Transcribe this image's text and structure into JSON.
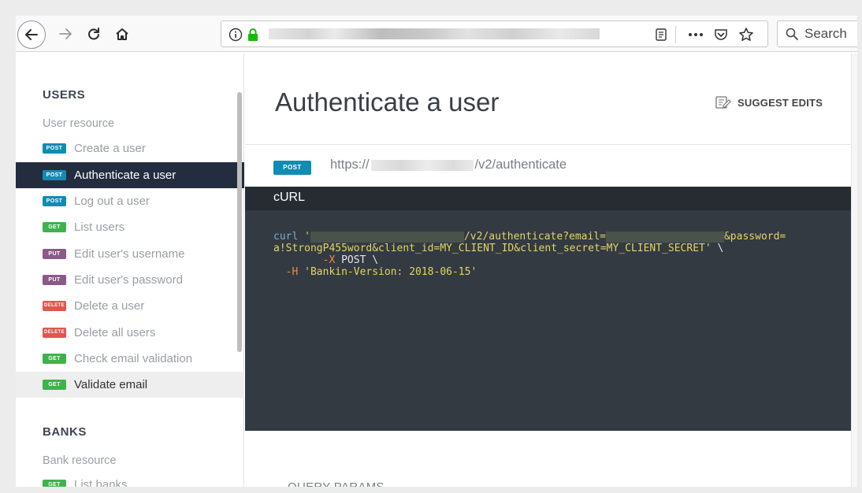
{
  "browser": {
    "search_label": "Search"
  },
  "sidebar": {
    "sections": [
      {
        "title": "USERS",
        "subtitle": "User resource"
      },
      {
        "title": "BANKS",
        "subtitle": "Bank resource"
      }
    ],
    "items": [
      {
        "method": "POST",
        "label": "Create a user"
      },
      {
        "method": "POST",
        "label": "Authenticate a user"
      },
      {
        "method": "POST",
        "label": "Log out a user"
      },
      {
        "method": "GET",
        "label": "List users"
      },
      {
        "method": "PUT",
        "label": "Edit user's username"
      },
      {
        "method": "PUT",
        "label": "Edit user's password"
      },
      {
        "method": "DELETE",
        "label": "Delete a user"
      },
      {
        "method": "DELETE",
        "label": "Delete all users"
      },
      {
        "method": "GET",
        "label": "Check email validation"
      },
      {
        "method": "GET",
        "label": "Validate email"
      },
      {
        "method": "GET",
        "label": "List banks"
      }
    ]
  },
  "main": {
    "title": "Authenticate a user",
    "suggest_label": "SUGGEST EDITS",
    "endpoint": {
      "method": "POST",
      "url_prefix": "https://",
      "url_suffix": "/v2/authenticate"
    },
    "curl": {
      "header": "cURL",
      "line1_cmd": "curl",
      "line1_q": " '",
      "line1_path": "/v2/authenticate?email=",
      "line1_tail": "&password=",
      "line2": "a!StrongP455word&client_id=MY_CLIENT_ID&client_secret=MY_CLIENT_SECRET'",
      "line2_tail": " \\",
      "line3_flag": "-X",
      "line3_rest": " POST \\",
      "line4_flag": "-H",
      "line4_rest": " 'Bankin-Version: 2018-06-15'"
    },
    "query_params_label": "QUERY PARAMS"
  }
}
